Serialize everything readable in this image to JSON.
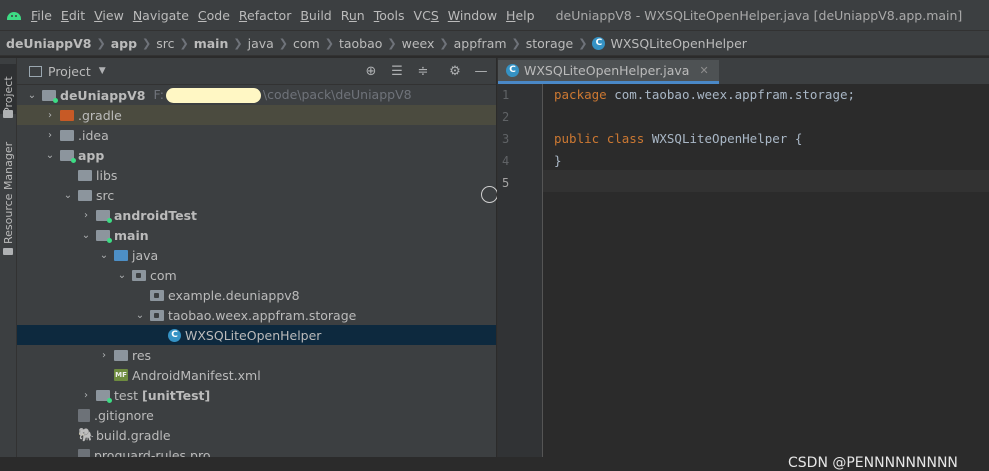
{
  "menubar": {
    "items": [
      "File",
      "Edit",
      "View",
      "Navigate",
      "Code",
      "Refactor",
      "Build",
      "Run",
      "Tools",
      "VCS",
      "Window",
      "Help"
    ],
    "mnemonics": [
      "F",
      "E",
      "V",
      "N",
      "C",
      "R",
      "B",
      "u",
      "T",
      "S",
      "W",
      "H"
    ],
    "window_title": "deUniappV8 - WXSQLiteOpenHelper.java [deUniappV8.app.main]"
  },
  "breadcrumb": {
    "items": [
      "deUniappV8",
      "app",
      "src",
      "main",
      "java",
      "com",
      "taobao",
      "weex",
      "appfram",
      "storage",
      "WXSQLiteOpenHelper"
    ],
    "class_icon": "C"
  },
  "toolstrip": {
    "project_tab": "Project",
    "resource_tab": "Resource Manager"
  },
  "project_panel": {
    "title": "Project",
    "header_icons": [
      "locate-icon",
      "expand-all-icon",
      "collapse-all-icon",
      "gear-icon",
      "minimize-icon"
    ],
    "tree": [
      {
        "label": "deUniappV8",
        "path_prefix": "F:",
        "path_suffix": "\\code\\pack\\deUniappV8"
      },
      {
        "label": ".gradle"
      },
      {
        "label": ".idea"
      },
      {
        "label": "app"
      },
      {
        "label": "libs"
      },
      {
        "label": "src"
      },
      {
        "label": "androidTest"
      },
      {
        "label": "main"
      },
      {
        "label": "java"
      },
      {
        "label": "com"
      },
      {
        "label": "example.deuniappv8"
      },
      {
        "label": "taobao.weex.appfram.storage"
      },
      {
        "label": "WXSQLiteOpenHelper",
        "icon_text": "C"
      },
      {
        "label": "res"
      },
      {
        "label": "AndroidManifest.xml",
        "icon_text": "MF"
      },
      {
        "label": "test",
        "suffix": "[unitTest]"
      },
      {
        "label": ".gitignore"
      },
      {
        "label": "build.gradle"
      },
      {
        "label": "proguard-rules.pro"
      }
    ]
  },
  "editor": {
    "tab_label": "WXSQLiteOpenHelper.java",
    "line_numbers": [
      "1",
      "2",
      "3",
      "4",
      "5"
    ],
    "code": {
      "l1_kw": "package",
      "l1_rest": " com.taobao.weex.appfram.storage;",
      "l3_kw1": "public",
      "l3_kw2": "class",
      "l3_rest": " WXSQLiteOpenHelper {",
      "l4": "}"
    }
  },
  "watermark": "CSDN @PENNNNNNNNN",
  "colors": {
    "background": "#2b2b2b",
    "panel": "#3c3f41",
    "selection": "#0d293e",
    "keyword": "#cc7832",
    "accent": "#4a88c7"
  }
}
